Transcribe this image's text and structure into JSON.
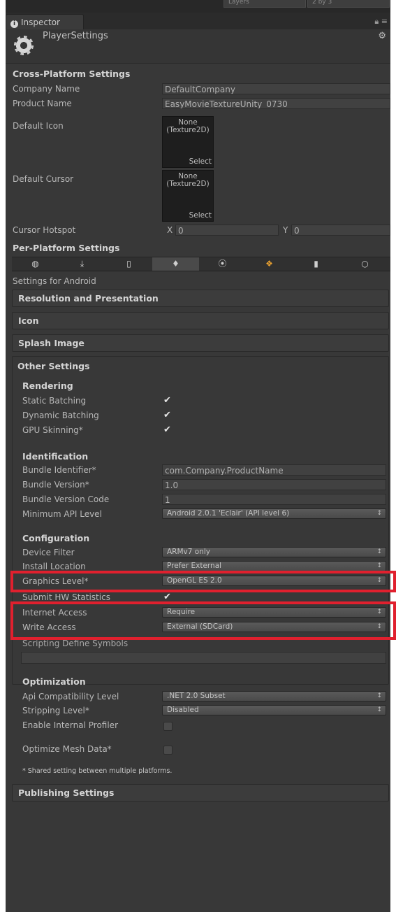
{
  "top": {
    "layers": "Layers",
    "layout": "2 by 3"
  },
  "tab": {
    "label": "Inspector",
    "menu_glyph": "≡"
  },
  "header": {
    "title": "PlayerSettings",
    "gear_glyph": "⚙"
  },
  "cross_platform": {
    "title": "Cross-Platform Settings",
    "company_label": "Company Name",
    "company_value": "DefaultCompany",
    "product_label": "Product Name",
    "product_value": "EasyMovieTextureUnity_0730",
    "icon_label": "Default Icon",
    "cursor_label": "Default Cursor",
    "texture_none": "None",
    "texture_type": "(Texture2D)",
    "select_label": "Select",
    "hotspot_label": "Cursor Hotspot",
    "hotspot_x_label": "X",
    "hotspot_x": "0",
    "hotspot_y_label": "Y",
    "hotspot_y": "0"
  },
  "per_platform": {
    "title": "Per-Platform Settings",
    "platform_icons": [
      "globe-icon",
      "download-icon",
      "phone-icon",
      "android-icon",
      "blackberry-icon",
      "windows-icon",
      "device-icon",
      "circle-icon"
    ],
    "platform_glyphs": [
      "◍",
      "⤓",
      "▯",
      "♦",
      "⦿",
      "❖",
      "▮",
      "○"
    ],
    "settings_for": "Settings for Android"
  },
  "sections": {
    "resolution": "Resolution and Presentation",
    "icon": "Icon",
    "splash": "Splash Image",
    "other": "Other Settings",
    "publishing": "Publishing Settings"
  },
  "rendering": {
    "title": "Rendering",
    "static_batching": "Static Batching",
    "dynamic_batching": "Dynamic Batching",
    "gpu_skinning": "GPU Skinning*"
  },
  "identification": {
    "title": "Identification",
    "bundle_id_label": "Bundle Identifier*",
    "bundle_id_value": "com.Company.ProductName",
    "bundle_version_label": "Bundle Version*",
    "bundle_version_value": "1.0",
    "bundle_code_label": "Bundle Version Code",
    "bundle_code_value": "1",
    "min_api_label": "Minimum API Level",
    "min_api_value": "Android 2.0.1 'Eclair' (API level 6)"
  },
  "configuration": {
    "title": "Configuration",
    "device_filter_label": "Device Filter",
    "device_filter_value": "ARMv7 only",
    "install_location_label": "Install Location",
    "install_location_value": "Prefer External",
    "graphics_level_label": "Graphics Level*",
    "graphics_level_value": "OpenGL ES 2.0",
    "submit_hw_label": "Submit HW Statistics",
    "internet_access_label": "Internet Access",
    "internet_access_value": "Require",
    "write_access_label": "Write Access",
    "write_access_value": "External (SDCard)",
    "scripting_define_label": "Scripting Define Symbols",
    "scripting_define_value": ""
  },
  "optimization": {
    "title": "Optimization",
    "api_compat_label": "Api Compatibility Level",
    "api_compat_value": ".NET 2.0 Subset",
    "stripping_label": "Stripping Level*",
    "stripping_value": "Disabled",
    "profiler_label": "Enable Internal Profiler",
    "optimize_mesh_label": "Optimize Mesh Data*",
    "footnote": "* Shared setting between multiple platforms."
  },
  "glyphs": {
    "check": "✔",
    "dropdown_arrow": "↕"
  },
  "highlight_color": "#e0202e"
}
